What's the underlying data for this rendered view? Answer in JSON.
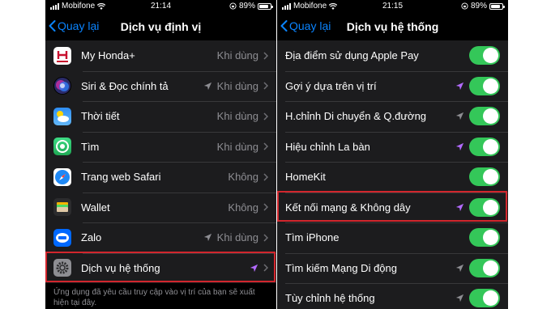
{
  "left_screen": {
    "status": {
      "carrier": "Mobifone",
      "time": "21:14",
      "battery": "89%"
    },
    "nav": {
      "back_label": "Quay lại",
      "title": "Dịch vụ định vị"
    },
    "rows": [
      {
        "label": "My Honda+",
        "value": "Khi dùng",
        "icon": "honda-icon",
        "arrow": "none"
      },
      {
        "label": "Siri & Đọc chính tả",
        "value": "Khi dùng",
        "icon": "siri-icon",
        "arrow": "gray"
      },
      {
        "label": "Thời tiết",
        "value": "Khi dùng",
        "icon": "weather-icon",
        "arrow": "none"
      },
      {
        "label": "Tìm",
        "value": "Khi dùng",
        "icon": "find-my-icon",
        "arrow": "none"
      },
      {
        "label": "Trang web Safari",
        "value": "Không",
        "icon": "safari-icon",
        "arrow": "none"
      },
      {
        "label": "Wallet",
        "value": "Không",
        "icon": "wallet-icon",
        "arrow": "none"
      },
      {
        "label": "Zalo",
        "value": "Khi dùng",
        "icon": "zalo-icon",
        "arrow": "gray"
      },
      {
        "label": "Dịch vụ hệ thống",
        "value": "",
        "icon": "settings-gear-icon",
        "arrow": "purple"
      }
    ],
    "footer": "Ứng dụng đã yêu cầu truy cập vào vị trí của bạn sẽ xuất hiện tại đây."
  },
  "right_screen": {
    "status": {
      "carrier": "Mobifone",
      "time": "21:15",
      "battery": "89%"
    },
    "nav": {
      "back_label": "Quay lại",
      "title": "Dịch vụ hệ thống"
    },
    "rows": [
      {
        "label": "Địa điểm sử dụng Apple Pay",
        "arrow": "none",
        "on": true
      },
      {
        "label": "Gợi ý dựa trên vị trí",
        "arrow": "purple",
        "on": true
      },
      {
        "label": "H.chỉnh Di chuyển & Q.đường",
        "arrow": "gray",
        "on": true
      },
      {
        "label": "Hiệu chỉnh La bàn",
        "arrow": "purple",
        "on": true
      },
      {
        "label": "HomeKit",
        "arrow": "none",
        "on": true
      },
      {
        "label": "Kết nối mạng & Không dây",
        "arrow": "purple",
        "on": true
      },
      {
        "label": "Tìm iPhone",
        "arrow": "none",
        "on": true
      },
      {
        "label": "Tìm kiếm Mạng Di động",
        "arrow": "gray",
        "on": true
      },
      {
        "label": "Tùy chỉnh hệ thống",
        "arrow": "gray",
        "on": true
      }
    ]
  },
  "colors": {
    "accent_blue": "#0a84ff",
    "toggle_green": "#34c759",
    "arrow_purple": "#b36bff",
    "arrow_gray": "#8e8e93",
    "highlight_red": "#d2262d"
  }
}
